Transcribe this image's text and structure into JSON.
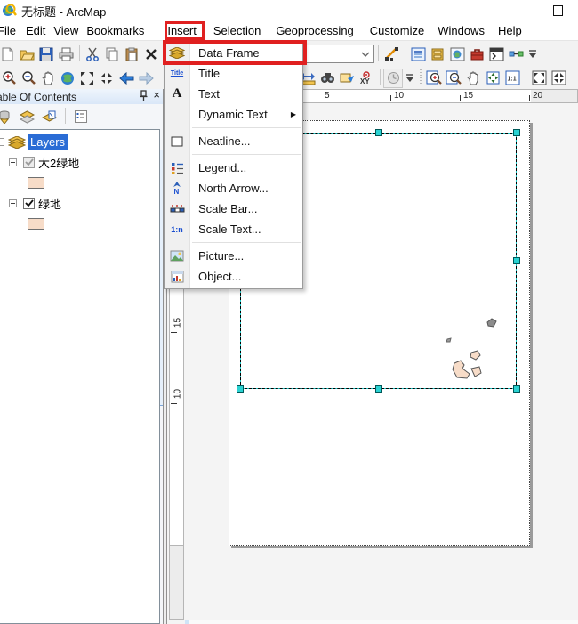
{
  "window": {
    "title": "无标题 - ArcMap",
    "controls": {
      "minimize": "—",
      "maximize": "maximize-box"
    }
  },
  "menubar": {
    "items": [
      "File",
      "Edit",
      "View",
      "Bookmarks",
      "Insert",
      "Selection",
      "Geoprocessing",
      "Customize",
      "Windows",
      "Help"
    ],
    "highlighted_item": "Insert"
  },
  "toolbars": {
    "standard": {
      "icons": [
        "new-document",
        "open",
        "save",
        "print",
        "cut",
        "copy",
        "paste",
        "delete",
        "edit-sketch-properties",
        "table-of-contents-window",
        "catalog-window",
        "search-window",
        "arctoolbox-window",
        "python-window",
        "modelbuilder-window",
        "toolbar-options"
      ],
      "scale_combo_value": ""
    },
    "tools": {
      "icons": [
        "zoom-in",
        "zoom-out",
        "pan",
        "full-extent",
        "fixed-zoom-in",
        "fixed-zoom-out",
        "go-back-extent",
        "go-forward-extent",
        "measure",
        "find",
        "hyperlink",
        "go-to-xy",
        "time-slider",
        "toolbar-options"
      ]
    },
    "layout_toolbar": {
      "icons": [
        "zoom-in-layout",
        "zoom-out-layout",
        "pan-layout",
        "zoom-whole-page",
        "zoom-100-percent",
        "fixed-zoom-in-layout",
        "fixed-zoom-out-layout"
      ]
    }
  },
  "insert_menu": {
    "highlighted_item": "Data Frame",
    "items": [
      {
        "label": "Data Frame",
        "icon": "data-frame-icon"
      },
      {
        "label": "Title",
        "icon": "title-icon"
      },
      {
        "label": "Text",
        "icon": "text-icon"
      },
      {
        "label": "Dynamic Text",
        "icon": "none",
        "submenu": true
      },
      {
        "label": "Neatline...",
        "icon": "neatline-icon"
      },
      {
        "label": "Legend...",
        "icon": "legend-icon"
      },
      {
        "label": "North Arrow...",
        "icon": "north-arrow-icon"
      },
      {
        "label": "Scale Bar...",
        "icon": "scale-bar-icon"
      },
      {
        "label": "Scale Text...",
        "icon": "scale-text-icon"
      },
      {
        "label": "Picture...",
        "icon": "picture-icon"
      },
      {
        "label": "Object...",
        "icon": "object-icon"
      }
    ]
  },
  "icon_glyphs": {
    "title": "Title",
    "text": "A",
    "north": "N",
    "scale_text": "1:n",
    "xy": "XY",
    "zoom100": "1:1"
  },
  "toc": {
    "title": "Table Of Contents",
    "toolbar_icons": [
      "list-by-drawing-order",
      "list-by-source",
      "list-by-visibility",
      "list-by-selection",
      "options"
    ],
    "tree": {
      "root_label": "Layers",
      "root_selected": true,
      "layers": [
        {
          "label": "大2绿地",
          "checked": true,
          "grayed": true,
          "swatch_color": "#f7dcc8"
        },
        {
          "label": "绿地",
          "checked": true,
          "grayed": false,
          "swatch_color": "#f7dcc8"
        }
      ]
    }
  },
  "layout": {
    "h_ruler_labels": [
      "5",
      "10",
      "15",
      "20"
    ],
    "v_ruler_labels": [
      "15",
      "10"
    ],
    "selection_handle_color": "#1fc8c8",
    "features": [
      {
        "name": "gray-polygon",
        "color": "#8c8c8c"
      },
      {
        "name": "peach-polygons",
        "color": "#f7dcc8"
      }
    ]
  },
  "colors": {
    "highlight_red": "#e02020",
    "selection_teal": "#1fc8c8",
    "toc_highlight_blue": "#2a6cd5",
    "swatch_peach": "#f7dcc8"
  }
}
